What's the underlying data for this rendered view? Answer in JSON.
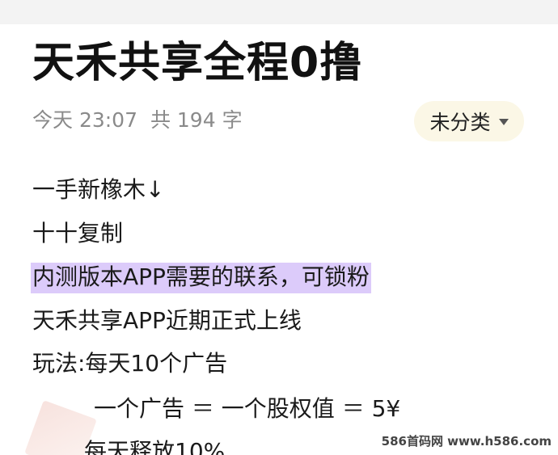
{
  "note": {
    "title": "天禾共享全程0撸",
    "date": "今天 23:07",
    "word_count": "共 194 字",
    "category": "未分类",
    "lines": [
      "一手新橡木↓",
      "十十复制",
      "内测版本APP需要的联系，可锁粉",
      "天禾共享APP近期正式上线",
      "玩法:每天10个广告",
      "一个广告 ＝ 一个股权值 ＝ 5¥",
      "每天释放10%"
    ]
  },
  "watermark": "586首码网 www.h586.com",
  "colors": {
    "highlight": "#dccbfa",
    "category_bg": "#fbf7e6",
    "meta_text": "#8a8a8a"
  },
  "icons": {
    "category_dropdown": "caret-down-icon"
  }
}
